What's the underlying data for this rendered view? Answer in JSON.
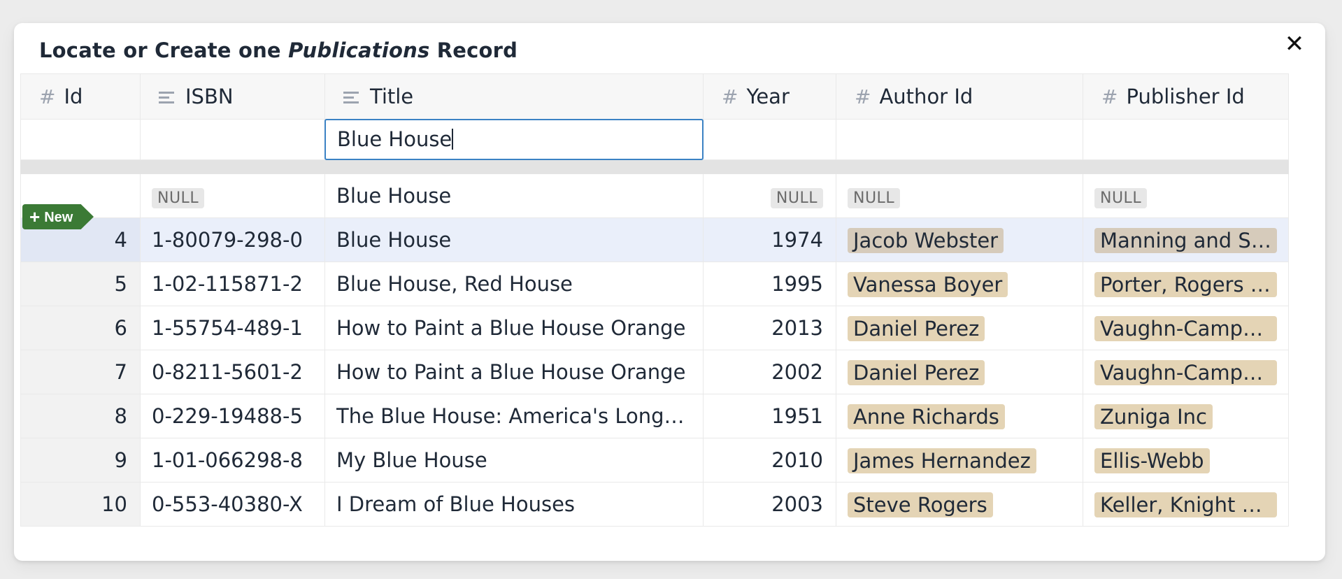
{
  "dialog": {
    "title_prefix": "Locate or Create one ",
    "title_entity": "Publications",
    "title_suffix": " Record",
    "close_label": "✕"
  },
  "columns": [
    {
      "label": "Id",
      "icon": "hash-icon",
      "glyph": "#"
    },
    {
      "label": "ISBN",
      "icon": "text-lines-icon"
    },
    {
      "label": "Title",
      "icon": "text-lines-icon"
    },
    {
      "label": "Year",
      "icon": "hash-icon",
      "glyph": "#"
    },
    {
      "label": "Author Id",
      "icon": "hash-icon",
      "glyph": "#"
    },
    {
      "label": "Publisher Id",
      "icon": "hash-icon",
      "glyph": "#"
    }
  ],
  "filter": {
    "title_value": "Blue House"
  },
  "new_row": {
    "tag_label": "New",
    "tag_icon": "plus-icon",
    "isbn": "NULL",
    "title": "Blue House",
    "year": "NULL",
    "author": "NULL",
    "publisher": "NULL"
  },
  "rows": [
    {
      "id": "4",
      "isbn": "1-80079-298-0",
      "title": "Blue House",
      "year": "1974",
      "author": "Jacob Webster",
      "publisher": "Manning and So…",
      "selected": true
    },
    {
      "id": "5",
      "isbn": "1-02-115871-2",
      "title": "Blue House, Red House",
      "year": "1995",
      "author": "Vanessa Boyer",
      "publisher": "Porter, Rogers a…"
    },
    {
      "id": "6",
      "isbn": "1-55754-489-1",
      "title": "How to Paint a Blue House Orange",
      "year": "2013",
      "author": "Daniel Perez",
      "publisher": "Vaughn-Campbell"
    },
    {
      "id": "7",
      "isbn": "0-8211-5601-2",
      "title": "How to Paint a Blue House Orange",
      "year": "2002",
      "author": "Daniel Perez",
      "publisher": "Vaughn-Campbell"
    },
    {
      "id": "8",
      "isbn": "0-229-19488-5",
      "title": "The Blue House: America's Longest…",
      "year": "1951",
      "author": "Anne Richards",
      "publisher": "Zuniga Inc"
    },
    {
      "id": "9",
      "isbn": "1-01-066298-8",
      "title": "My Blue House",
      "year": "2010",
      "author": "James Hernandez",
      "publisher": "Ellis-Webb"
    },
    {
      "id": "10",
      "isbn": "0-553-40380-X",
      "title": "I Dream of Blue Houses",
      "year": "2003",
      "author": "Steve Rogers",
      "publisher": "Keller, Knight an…"
    }
  ],
  "colors": {
    "accent_border": "#3b82c4",
    "new_tag": "#3b7a35",
    "link_chip": "#e4d4b5",
    "selected_row": "#eaeffa"
  }
}
